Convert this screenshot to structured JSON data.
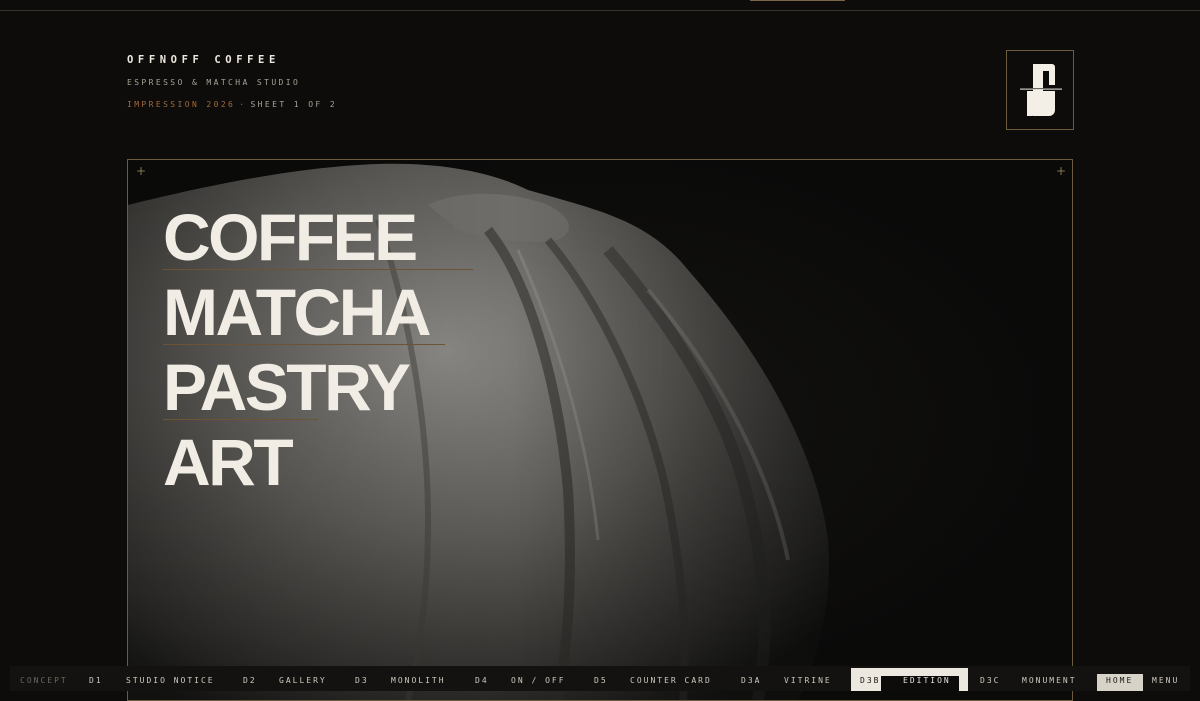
{
  "brand": {
    "name": "OFFNOFF COFFEE",
    "subtitle": "ESPRESSO & MATCHA STUDIO",
    "impression": "IMPRESSION 2026",
    "separator": "·",
    "sheet": "SHEET 1 OF 2",
    "logo_icon": "offnoff-monogram-icon"
  },
  "hero": {
    "lines": [
      "COFFEE",
      "MATCHA",
      "PASTRY",
      "ART"
    ],
    "corner_marks": [
      "+",
      "+"
    ],
    "image": "draped-marble-statue"
  },
  "nav": {
    "concept": "CONCEPT",
    "items": [
      {
        "code": "D1",
        "label": "STUDIO NOTICE"
      },
      {
        "code": "D2",
        "label": "GALLERY"
      },
      {
        "code": "D3",
        "label": "MONOLITH"
      },
      {
        "code": "D4",
        "label": "ON / OFF"
      },
      {
        "code": "D5",
        "label": "COUNTER CARD"
      },
      {
        "code": "D3A",
        "label": "VITRINE"
      },
      {
        "code": "D3B",
        "label": "EDITION"
      },
      {
        "code": "D3C",
        "label": "MONUMENT"
      }
    ],
    "home": "HOME",
    "menu": "MENU",
    "active": "D3B"
  },
  "colors": {
    "background": "#0d0c0a",
    "accent": "#a06a3c",
    "frame": "#6e5a3c",
    "text": "#ece8df"
  }
}
